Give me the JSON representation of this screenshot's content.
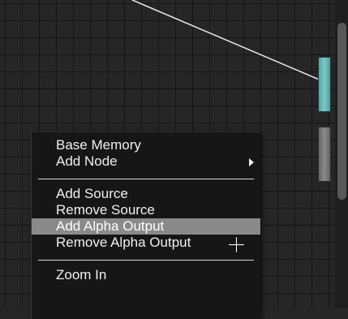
{
  "context_menu": {
    "items": [
      {
        "label": "Base Memory"
      },
      {
        "label": "Add Node",
        "has_submenu": true
      },
      {
        "label": "Add Source"
      },
      {
        "label": "Remove Source"
      },
      {
        "label": "Add Alpha Output",
        "highlighted": true
      },
      {
        "label": "Remove Alpha Output"
      },
      {
        "label": "Zoom In"
      }
    ]
  },
  "icons": {
    "cursor": "crosshair-cursor-icon",
    "submenu": "submenu-arrow-icon"
  },
  "colors": {
    "canvas_background": "#262626",
    "grid_line": "#151515",
    "menu_background": "#161616",
    "menu_highlight": "#8a8a8a",
    "menu_text": "#f0f0f0",
    "port_active": "#7fc7c5",
    "port_inactive": "#8a8a8a",
    "wire": "#e8e8e8"
  }
}
